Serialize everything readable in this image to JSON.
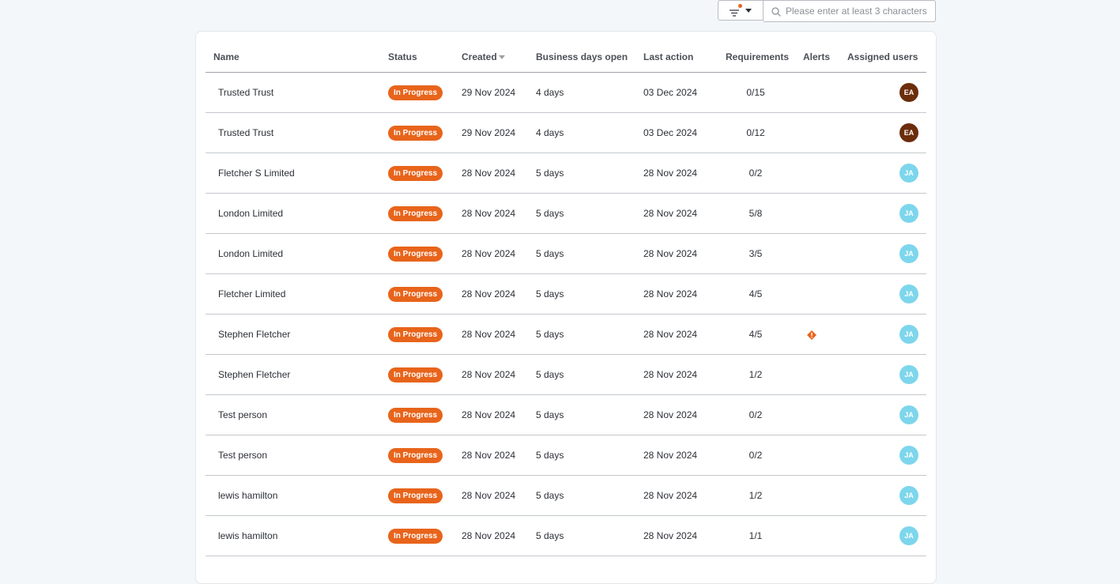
{
  "toolbar": {
    "search_placeholder": "Please enter at least 3 characters"
  },
  "colors": {
    "status_badge": "#e8641b",
    "avatar_ea": "#6b2d0c",
    "avatar_ja": "#7dd6ec",
    "alert": "#e8641b"
  },
  "columns": {
    "name": "Name",
    "status": "Status",
    "created": "Created",
    "business_days_open": "Business days open",
    "last_action": "Last action",
    "requirements": "Requirements",
    "alerts": "Alerts",
    "assigned_users": "Assigned users"
  },
  "rows": [
    {
      "name": "Trusted Trust",
      "status": "In Progress",
      "created": "29 Nov 2024",
      "days": "4 days",
      "last_action": "03 Dec 2024",
      "requirements": "0/15",
      "alert": false,
      "user": "EA"
    },
    {
      "name": "Trusted Trust",
      "status": "In Progress",
      "created": "29 Nov 2024",
      "days": "4 days",
      "last_action": "03 Dec 2024",
      "requirements": "0/12",
      "alert": false,
      "user": "EA"
    },
    {
      "name": "Fletcher S Limited",
      "status": "In Progress",
      "created": "28 Nov 2024",
      "days": "5 days",
      "last_action": "28 Nov 2024",
      "requirements": "0/2",
      "alert": false,
      "user": "JA"
    },
    {
      "name": "London Limited",
      "status": "In Progress",
      "created": "28 Nov 2024",
      "days": "5 days",
      "last_action": "28 Nov 2024",
      "requirements": "5/8",
      "alert": false,
      "user": "JA"
    },
    {
      "name": "London Limited",
      "status": "In Progress",
      "created": "28 Nov 2024",
      "days": "5 days",
      "last_action": "28 Nov 2024",
      "requirements": "3/5",
      "alert": false,
      "user": "JA"
    },
    {
      "name": "Fletcher Limited",
      "status": "In Progress",
      "created": "28 Nov 2024",
      "days": "5 days",
      "last_action": "28 Nov 2024",
      "requirements": "4/5",
      "alert": false,
      "user": "JA"
    },
    {
      "name": "Stephen Fletcher",
      "status": "In Progress",
      "created": "28 Nov 2024",
      "days": "5 days",
      "last_action": "28 Nov 2024",
      "requirements": "4/5",
      "alert": true,
      "user": "JA"
    },
    {
      "name": "Stephen Fletcher",
      "status": "In Progress",
      "created": "28 Nov 2024",
      "days": "5 days",
      "last_action": "28 Nov 2024",
      "requirements": "1/2",
      "alert": false,
      "user": "JA"
    },
    {
      "name": "Test person",
      "status": "In Progress",
      "created": "28 Nov 2024",
      "days": "5 days",
      "last_action": "28 Nov 2024",
      "requirements": "0/2",
      "alert": false,
      "user": "JA"
    },
    {
      "name": "Test person",
      "status": "In Progress",
      "created": "28 Nov 2024",
      "days": "5 days",
      "last_action": "28 Nov 2024",
      "requirements": "0/2",
      "alert": false,
      "user": "JA"
    },
    {
      "name": "lewis hamilton",
      "status": "In Progress",
      "created": "28 Nov 2024",
      "days": "5 days",
      "last_action": "28 Nov 2024",
      "requirements": "1/2",
      "alert": false,
      "user": "JA"
    },
    {
      "name": "lewis hamilton",
      "status": "In Progress",
      "created": "28 Nov 2024",
      "days": "5 days",
      "last_action": "28 Nov 2024",
      "requirements": "1/1",
      "alert": false,
      "user": "JA"
    }
  ]
}
